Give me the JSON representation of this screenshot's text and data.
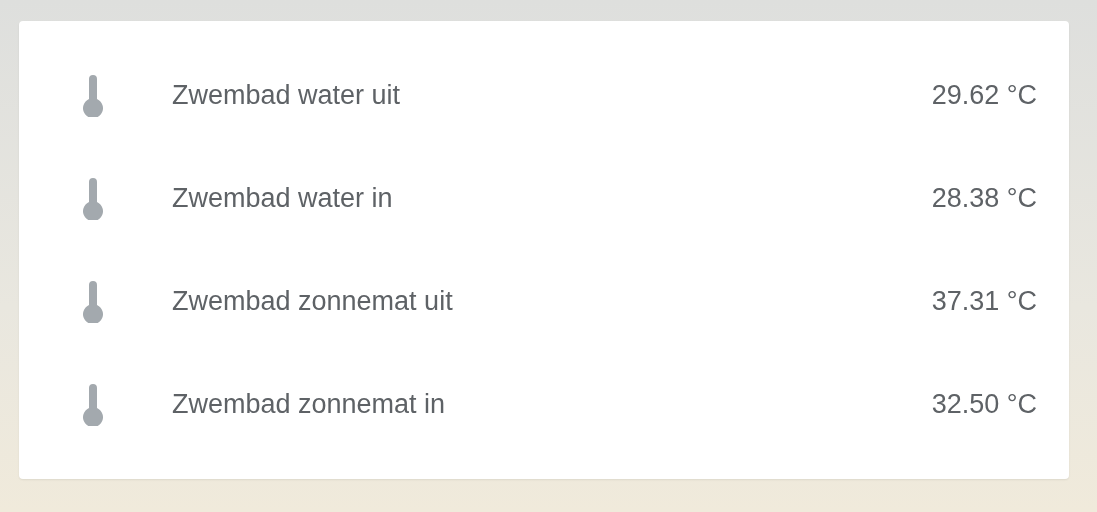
{
  "sensors": [
    {
      "name": "Zwembad water uit",
      "value": "29.62 °C"
    },
    {
      "name": "Zwembad water in",
      "value": "28.38 °C"
    },
    {
      "name": "Zwembad zonnemat uit",
      "value": "37.31 °C"
    },
    {
      "name": "Zwembad zonnemat in",
      "value": "32.50 °C"
    }
  ]
}
